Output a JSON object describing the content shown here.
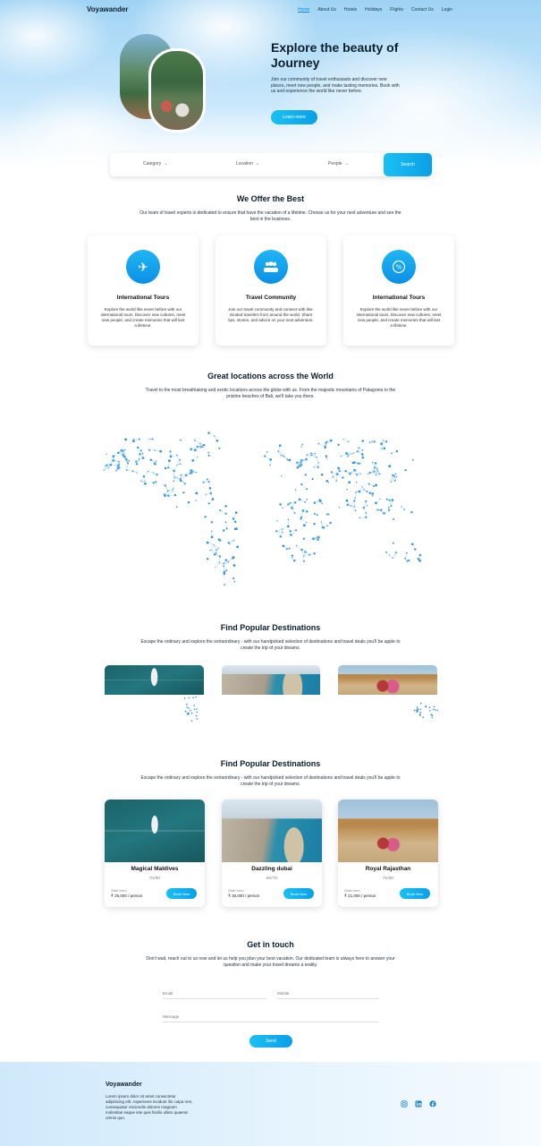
{
  "nav": {
    "brand": "Voyawander",
    "links": [
      "Home",
      "About Us",
      "Hotels",
      "Holidays",
      "Flights",
      "Contact Us",
      "Login"
    ]
  },
  "hero": {
    "title": "Explore the beauty of Journey",
    "text": "Join our community of travel enthusiasts and discover new places, meet new people, and make lasting memories. Book with us and experience the world like never before.",
    "cta": "Learn more"
  },
  "search": {
    "category": "Category",
    "location": "Location",
    "people": "People",
    "button": "Search"
  },
  "offer": {
    "title": "We Offer the Best",
    "text": "Our team of travel experts is dedicated to ensure that have the vacation of a lifetime. Choose us for your next adventure and see the best in the business.",
    "cards": [
      {
        "title": "International Tours",
        "text": "Explore the world like never before with our international tours. Discover new cultures, meet new people, and create memories that will last a lifetime."
      },
      {
        "title": "Travel Community",
        "text": "Join our travel community and connect with like-minded travelers from around the world. Share tips, stories, and advice on your next adventure."
      },
      {
        "title": "International Tours",
        "text": "Explore the world like never before with our international tours. Discover new cultures, meet new people, and create memories that will last a lifetime."
      }
    ]
  },
  "locations": {
    "title": "Great locations across the World",
    "text": "Travel to the most breathtaking and exotic locations across the globe with us. From the majestic mountains of Patagonia to the pristine beaches of Bali, we'll take you there."
  },
  "popular_preview": {
    "title": "Find Popular Destinations",
    "text": "Escape the ordinary and explore the extraordinary - with our handpicked selection of destinations and travel deals you'll be apple to create the trip of your dreams."
  },
  "popular": {
    "title": "Find Popular Destinations",
    "text": "Escape the ordinary and explore the extraordinary - with our handpicked selection of destinations and travel deals you'll be apple to create the trip of your dreams.",
    "cards": [
      {
        "name": "Magical Maldives",
        "nights": "7N/8D",
        "start_label": "Start from",
        "price": "₹ 25,000 / person",
        "button": "Book Now"
      },
      {
        "name": "Dazzling dubai",
        "nights": "6N/7D",
        "start_label": "Start from",
        "price": "₹ 30,000 / person",
        "button": "Book Now"
      },
      {
        "name": "Royal Rajasthan",
        "nights": "7N/8D",
        "start_label": "Start from",
        "price": "₹ 21,000 / person",
        "button": "Book Now"
      }
    ]
  },
  "contact": {
    "title": "Get in touch",
    "text": "Don't wait, reach out to us now and let us help you plan your best vacation. Our dedicated team is always here to answer your question and make your travel dreams a reality.",
    "email_label": "Email",
    "mobile_label": "Mobile",
    "message_label": "Message",
    "send": "Send"
  },
  "footer": {
    "brand": "Voyawander",
    "text": "Lorem ipsum dolor sit amet consectetur adipisicing elit. Asperiores incidunt illo culpa rem, consequatur reiciendis dolores magnam molestiae eaque iste quis facilis ullam quaerat omnis quo."
  },
  "social_icons": [
    "instagram-icon",
    "linkedin-icon",
    "facebook-icon"
  ],
  "colors": {
    "accent": "#0b9fe8",
    "accent_light": "#19c1f2",
    "text_dark": "#0b1e2c"
  }
}
